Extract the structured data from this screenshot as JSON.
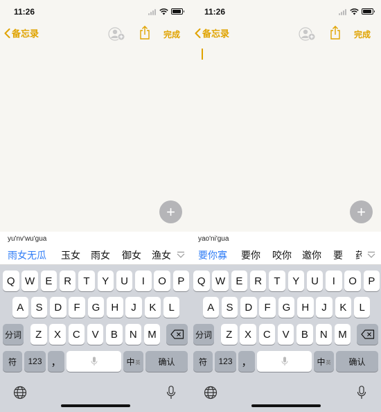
{
  "colors": {
    "accent": "#e0a300",
    "candidate_highlight": "#2f7cf6",
    "keyboard_bg": "#d2d5db"
  },
  "screens": [
    {
      "status": {
        "time": "11:26"
      },
      "nav": {
        "back": "备忘录",
        "done": "完成"
      },
      "pinyin": "yu'nv'wu'gua",
      "candidates": [
        "雨女无瓜",
        "玉女",
        "雨女",
        "御女",
        "渔女"
      ]
    },
    {
      "status": {
        "time": "11:26"
      },
      "nav": {
        "back": "备忘录",
        "done": "完成"
      },
      "pinyin": "yao'ni'gua",
      "candidates": [
        "要你寡",
        "要你",
        "咬你",
        "邀你",
        "要",
        "药"
      ]
    }
  ],
  "keyboard": {
    "row1": [
      "Q",
      "W",
      "E",
      "R",
      "T",
      "Y",
      "U",
      "I",
      "O",
      "P"
    ],
    "row2": [
      "A",
      "S",
      "D",
      "F",
      "G",
      "H",
      "J",
      "K",
      "L"
    ],
    "row3": [
      "Z",
      "X",
      "C",
      "V",
      "B",
      "N",
      "M"
    ],
    "fenci": "分词",
    "fu": "符",
    "num": "123",
    "punct": "，",
    "zh": "中",
    "en": "英",
    "confirm": "确认"
  }
}
